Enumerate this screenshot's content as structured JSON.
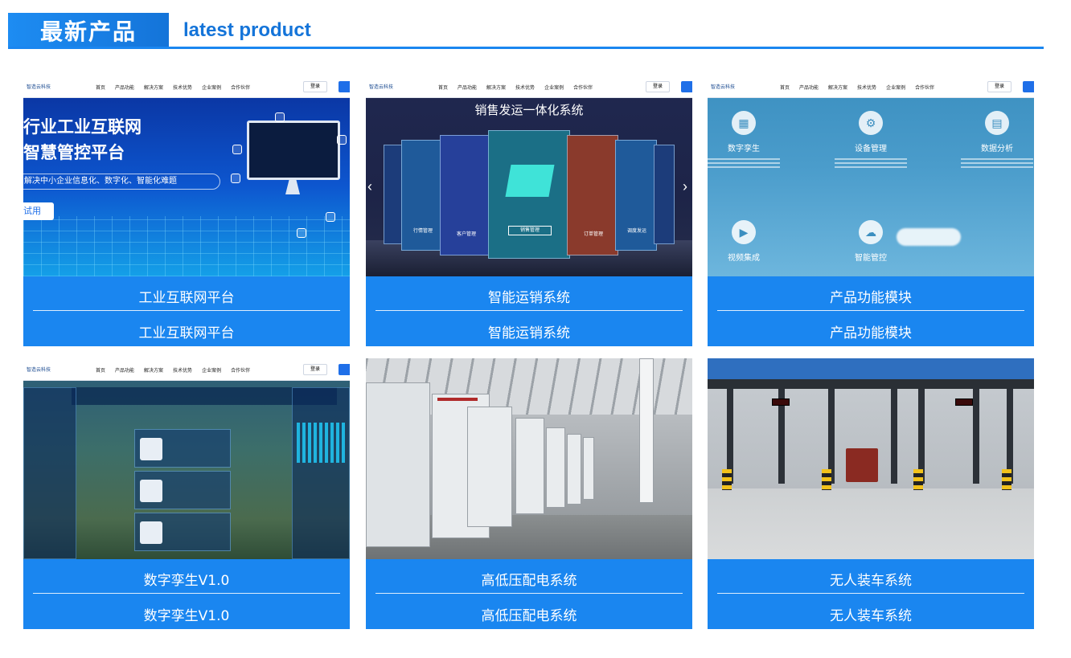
{
  "header": {
    "title": "最新产品",
    "subtitle": "latest product"
  },
  "mock_nav": {
    "logo": "智造云科技",
    "links": [
      "首页",
      "产品功能",
      "解决方案",
      "技术优势",
      "企业案例",
      "合作伙伴"
    ],
    "login": "登录"
  },
  "cards": [
    {
      "caption_primary": "工业互联网平台",
      "caption_secondary": "工业互联网平台",
      "screen": {
        "headline_1": "行业工业互联网",
        "headline_2": "智慧管控平台",
        "pill": "解决中小企业信息化、数字化、智能化难题",
        "button": "试用"
      }
    },
    {
      "caption_primary": "智能运销系统",
      "caption_secondary": "智能运销系统",
      "screen": {
        "title": "销售发运一体化系统",
        "panel_labels": [
          "行情管理",
          "客户管理",
          "销售管理",
          "订单管理",
          "调度发运"
        ]
      }
    },
    {
      "caption_primary": "产品功能模块",
      "caption_secondary": "产品功能模块",
      "screen": {
        "features": [
          "数字孪生",
          "设备管理",
          "数据分析",
          "视频集成",
          "智能管控"
        ]
      }
    },
    {
      "caption_primary": "数字孪生V1.0",
      "caption_secondary": "数字孪生V1.0"
    },
    {
      "caption_primary": "高低压配电系统",
      "caption_secondary": "高低压配电系统"
    },
    {
      "caption_primary": "无人装车系统",
      "caption_secondary": "无人装车系统"
    }
  ],
  "colors": {
    "accent": "#1a86f0",
    "header_gradient_start": "#1d8cf2",
    "header_gradient_end": "#1474d9",
    "caption_text": "#ffffff"
  }
}
